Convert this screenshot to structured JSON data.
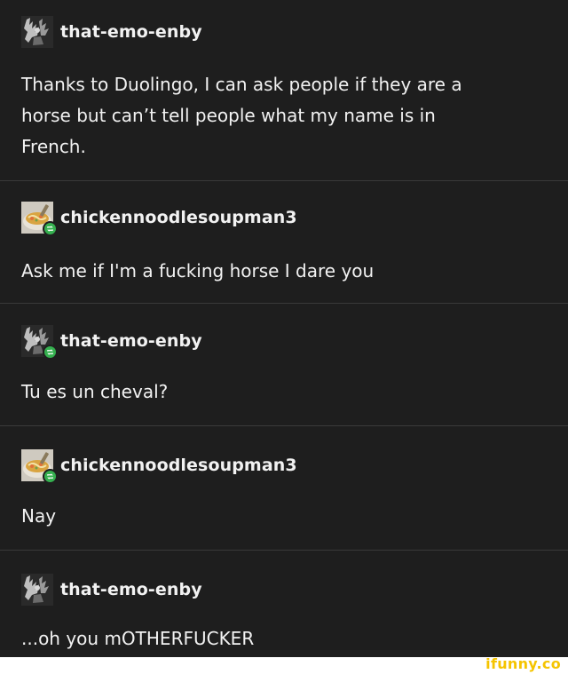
{
  "posts": [
    {
      "username": "that-emo-enby",
      "avatar": "emo-figure-avatar",
      "reblogged": false,
      "text_lines": [
        "Thanks to Duolingo, I can ask people if they are a",
        "horse but can’t tell people what my name is in",
        "French."
      ]
    },
    {
      "username": "chickennoodlesoupman3",
      "avatar": "soup-bowl-avatar",
      "reblogged": true,
      "text_lines": [
        "Ask me if I'm a fucking horse I dare you"
      ]
    },
    {
      "username": "that-emo-enby",
      "avatar": "emo-figure-avatar",
      "reblogged": true,
      "text_lines": [
        "Tu es un cheval?"
      ]
    },
    {
      "username": "chickennoodlesoupman3",
      "avatar": "soup-bowl-avatar",
      "reblogged": true,
      "text_lines": [
        "Nay"
      ]
    },
    {
      "username": "that-emo-enby",
      "avatar": "emo-figure-avatar",
      "reblogged": false,
      "text_lines": [
        "...oh you mOTHERFUCKER"
      ]
    }
  ],
  "watermark": "ifunny.co",
  "colors": {
    "background": "#1e1e1e",
    "text": "#f2f2f2",
    "divider": "#3a3a3a",
    "reblog_badge": "#35b04f",
    "watermark": "#f5c400"
  }
}
